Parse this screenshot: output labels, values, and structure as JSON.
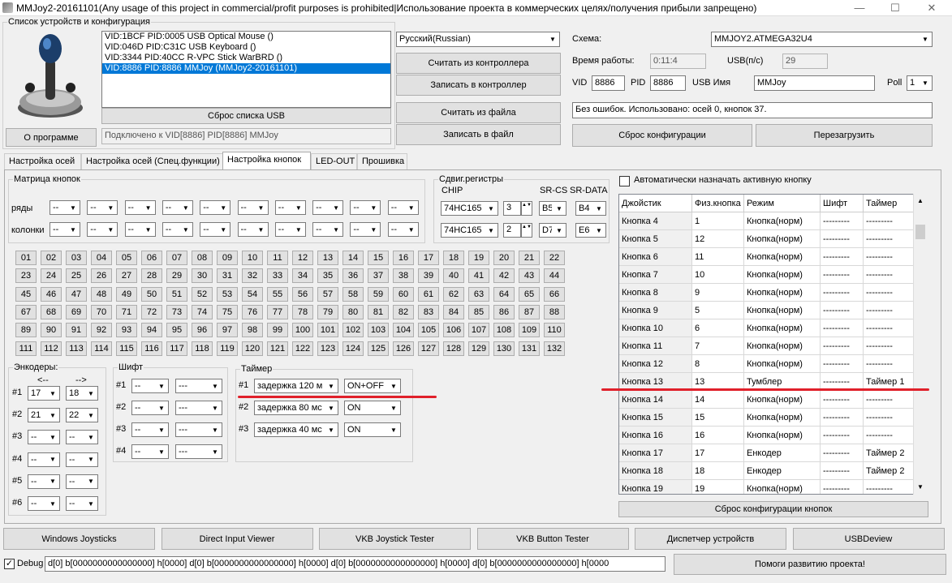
{
  "window": {
    "title": "MMJoy2-20161101(Any usage of this project in commercial/profit purposes is prohibited|Использование проекта в коммерческих целях/получения прибыли запрещено)",
    "minimize": "—",
    "maximize": "☐",
    "close": "✕"
  },
  "devices": {
    "legend": "Список устройств и конфигурация",
    "list": [
      "VID:1BCF PID:0005 USB Optical Mouse ()",
      "VID:046D PID:C31C USB Keyboard ()",
      "VID:3344 PID:40CC R-VPC Stick WarBRD ()",
      "VID:8886 PID:8886 MMJoy (MMJoy2-20161101)"
    ],
    "reset_usb": "Сброс списка USB",
    "about": "О программе",
    "connected": "Подключено к VID[8886] PID[8886] MMJoy"
  },
  "lang": {
    "value": "Русский(Russian)"
  },
  "actions": {
    "read_ctrl": "Считать из контроллера",
    "write_ctrl": "Записать в контроллер",
    "read_file": "Считать из файла",
    "write_file": "Записать в файл"
  },
  "config": {
    "schema_label": "Схема:",
    "schema_value": "MMJOY2.ATMEGA32U4",
    "uptime_label": "Время работы:",
    "uptime_value": "0:11:4",
    "usb_label": "USB(п/с)",
    "usb_value": "29",
    "vid_label": "VID",
    "vid_value": "8886",
    "pid_label": "PID",
    "pid_value": "8886",
    "usbname_label": "USB Имя",
    "usbname_value": "MMJoy",
    "poll_label": "Poll",
    "poll_value": "1",
    "status": "Без ошибок. Использовано: осей  0, кнопок  37.",
    "reset_cfg": "Сброс конфигурации",
    "reboot": "Перезагрузить"
  },
  "tabs": [
    "Настройка осей",
    "Настройка осей (Спец.функции)",
    "Настройка кнопок",
    "LED-OUT",
    "Прошивка"
  ],
  "matrix": {
    "legend": "Матрица кнопок",
    "rows_label": "ряды",
    "cols_label": "колонки",
    "cell": "--"
  },
  "shift_regs": {
    "legend": "Сдвиг.регистры",
    "chip_label": "CHIP",
    "srcs_label": "SR-CS",
    "srdata_label": "SR-DATA",
    "rows": [
      {
        "chip": "74HC165",
        "n": "3",
        "cs": "B5",
        "data": "B4"
      },
      {
        "chip": "74HC165",
        "n": "2",
        "cs": "D7",
        "data": "E6"
      }
    ]
  },
  "buttons": [
    "01",
    "02",
    "03",
    "04",
    "05",
    "06",
    "07",
    "08",
    "09",
    "10",
    "11",
    "12",
    "13",
    "14",
    "15",
    "16",
    "17",
    "18",
    "19",
    "20",
    "21",
    "22",
    "23",
    "24",
    "25",
    "26",
    "27",
    "28",
    "29",
    "30",
    "31",
    "32",
    "33",
    "34",
    "35",
    "36",
    "37",
    "38",
    "39",
    "40",
    "41",
    "42",
    "43",
    "44",
    "45",
    "46",
    "47",
    "48",
    "49",
    "50",
    "51",
    "52",
    "53",
    "54",
    "55",
    "56",
    "57",
    "58",
    "59",
    "60",
    "61",
    "62",
    "63",
    "64",
    "65",
    "66",
    "67",
    "68",
    "69",
    "70",
    "71",
    "72",
    "73",
    "74",
    "75",
    "76",
    "77",
    "78",
    "79",
    "80",
    "81",
    "82",
    "83",
    "84",
    "85",
    "86",
    "87",
    "88",
    "89",
    "90",
    "91",
    "92",
    "93",
    "94",
    "95",
    "96",
    "97",
    "98",
    "99",
    "100",
    "101",
    "102",
    "103",
    "104",
    "105",
    "106",
    "107",
    "108",
    "109",
    "110",
    "111",
    "112",
    "113",
    "114",
    "115",
    "116",
    "117",
    "118",
    "119",
    "120",
    "121",
    "122",
    "123",
    "124",
    "125",
    "126",
    "127",
    "128",
    "129",
    "130",
    "131",
    "132"
  ],
  "encoders": {
    "legend": "Энкодеры:",
    "left_label": "<--",
    "right_label": "-->",
    "rows": [
      {
        "n": "#1",
        "a": "17",
        "b": "18"
      },
      {
        "n": "#2",
        "a": "21",
        "b": "22"
      },
      {
        "n": "#3",
        "a": "--",
        "b": "--"
      },
      {
        "n": "#4",
        "a": "--",
        "b": "--"
      },
      {
        "n": "#5",
        "a": "--",
        "b": "--"
      },
      {
        "n": "#6",
        "a": "--",
        "b": "--"
      }
    ]
  },
  "shift": {
    "legend": "Шифт",
    "rows": [
      {
        "n": "#1",
        "a": "--",
        "b": "---"
      },
      {
        "n": "#2",
        "a": "--",
        "b": "---"
      },
      {
        "n": "#3",
        "a": "--",
        "b": "---"
      },
      {
        "n": "#4",
        "a": "--",
        "b": "---"
      }
    ]
  },
  "timer": {
    "legend": "Таймер",
    "rows": [
      {
        "n": "#1",
        "a": "задержка 120 м",
        "b": "ON+OFF"
      },
      {
        "n": "#2",
        "a": "задержка 80 мс",
        "b": "ON"
      },
      {
        "n": "#3",
        "a": "задержка 40 мс",
        "b": "ON"
      }
    ]
  },
  "autoassign": {
    "label": "Автоматически назначать активную кнопку"
  },
  "table": {
    "headers": [
      "Джойстик",
      "Физ.кнопка",
      "Режим",
      "Шифт",
      "Таймер"
    ],
    "rows": [
      [
        "Кнопка 4",
        "1",
        "Кнопка(норм)",
        "---------",
        "---------"
      ],
      [
        "Кнопка 5",
        "12",
        "Кнопка(норм)",
        "---------",
        "---------"
      ],
      [
        "Кнопка 6",
        "11",
        "Кнопка(норм)",
        "---------",
        "---------"
      ],
      [
        "Кнопка 7",
        "10",
        "Кнопка(норм)",
        "---------",
        "---------"
      ],
      [
        "Кнопка 8",
        "9",
        "Кнопка(норм)",
        "---------",
        "---------"
      ],
      [
        "Кнопка 9",
        "5",
        "Кнопка(норм)",
        "---------",
        "---------"
      ],
      [
        "Кнопка 10",
        "6",
        "Кнопка(норм)",
        "---------",
        "---------"
      ],
      [
        "Кнопка 11",
        "7",
        "Кнопка(норм)",
        "---------",
        "---------"
      ],
      [
        "Кнопка 12",
        "8",
        "Кнопка(норм)",
        "---------",
        "---------"
      ],
      [
        "Кнопка 13",
        "13",
        "Тумблер",
        "---------",
        "Таймер 1"
      ],
      [
        "Кнопка 14",
        "14",
        "Кнопка(норм)",
        "---------",
        "---------"
      ],
      [
        "Кнопка 15",
        "15",
        "Кнопка(норм)",
        "---------",
        "---------"
      ],
      [
        "Кнопка 16",
        "16",
        "Кнопка(норм)",
        "---------",
        "---------"
      ],
      [
        "Кнопка 17",
        "17",
        "Енкодер",
        "---------",
        "Таймер 2"
      ],
      [
        "Кнопка 18",
        "18",
        "Енкодер",
        "---------",
        "Таймер 2"
      ],
      [
        "Кнопка 19",
        "19",
        "Кнопка(норм)",
        "---------",
        "---------"
      ]
    ],
    "reset": "Сброс конфигурации кнопок"
  },
  "bottom": [
    "Windows Joysticks",
    "Direct Input Viewer",
    "VKB Joystick Tester",
    "VKB Button Tester",
    "Диспетчер устройств",
    "USBDeview"
  ],
  "debug": {
    "label": "Debug",
    "value": "d[0] b[0000000000000000] h[0000]   d[0] b[0000000000000000] h[0000]   d[0] b[0000000000000000] h[0000]   d[0] b[0000000000000000] h[0000",
    "help": "Помоги развитию проекта!"
  },
  "colors": {
    "accent": "#0078d7",
    "annotation": "#e0202a"
  }
}
